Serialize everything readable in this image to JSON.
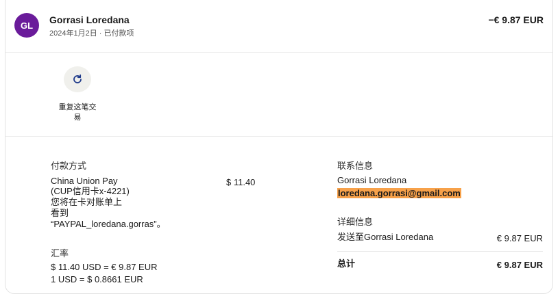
{
  "header": {
    "avatar_initials": "GL",
    "avatar_color": "#6a1b9a",
    "name": "Gorrasi Loredana",
    "subtitle": "2024年1月2日 · 已付款项",
    "amount": "−€ 9.87 EUR"
  },
  "actions": {
    "repeat_label": "重复这笔交易",
    "repeat_icon": "refresh-icon"
  },
  "payment": {
    "heading": "付款方式",
    "method_lines": [
      "China Union Pay",
      "(CUP信用卡x-4221)",
      "您将在卡对账单上",
      "看到",
      "“PAYPAL_loredana.gorras”。"
    ],
    "amount": "$ 11.40"
  },
  "exchange": {
    "heading": "汇率",
    "line1": "$ 11.40 USD = € 9.87 EUR",
    "line2": "1 USD = $ 0.8661 EUR"
  },
  "contact": {
    "heading": "联系信息",
    "name": "Gorrasi Loredana",
    "email": "loredana.gorrasi@gmail.com"
  },
  "details": {
    "heading": "详细信息",
    "sent_to": "发送至Gorrasi Loredana",
    "sent_amount": "€ 9.87 EUR",
    "total_label": "总计",
    "total_amount": "€ 9.87 EUR"
  },
  "colors": {
    "accent": "#6a1b9a",
    "highlight": "#f7a14a",
    "icon_blue": "#1e3a8a"
  }
}
